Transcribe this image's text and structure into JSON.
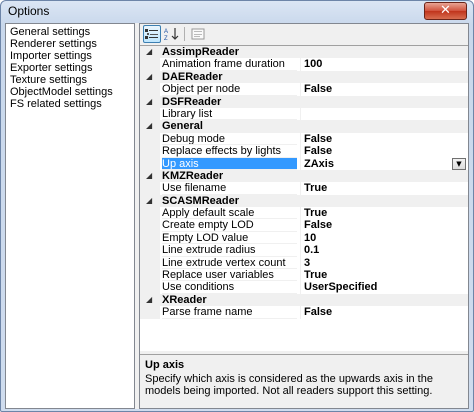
{
  "window": {
    "title": "Options",
    "close_glyph": "✕"
  },
  "categories": [
    "General settings",
    "Renderer settings",
    "Importer settings",
    "Exporter settings",
    "Texture settings",
    "ObjectModel settings",
    "FS related settings"
  ],
  "toolbar": {
    "categorized_icon": "categorized-icon",
    "alphabetical_icon": "alphabetical-sort-icon",
    "pages_icon": "property-pages-icon"
  },
  "grid": {
    "groups": [
      {
        "name": "AssimpReader",
        "props": [
          {
            "name": "Animation frame duration",
            "value": "100"
          }
        ]
      },
      {
        "name": "DAEReader",
        "props": [
          {
            "name": "Object per node",
            "value": "False"
          }
        ]
      },
      {
        "name": "DSFReader",
        "props": [
          {
            "name": "Library list",
            "value": ""
          }
        ]
      },
      {
        "name": "General",
        "props": [
          {
            "name": "Debug mode",
            "value": "False"
          },
          {
            "name": "Replace effects by lights",
            "value": "False"
          },
          {
            "name": "Up axis",
            "value": "ZAxis",
            "selected": true
          }
        ]
      },
      {
        "name": "KMZReader",
        "props": [
          {
            "name": "Use filename",
            "value": "True"
          }
        ]
      },
      {
        "name": "SCASMReader",
        "props": [
          {
            "name": "Apply default scale",
            "value": "True"
          },
          {
            "name": "Create empty LOD",
            "value": "False"
          },
          {
            "name": "Empty LOD value",
            "value": "10"
          },
          {
            "name": "Line extrude radius",
            "value": "0.1"
          },
          {
            "name": "Line extrude vertex count",
            "value": "3"
          },
          {
            "name": "Replace user variables",
            "value": "True"
          },
          {
            "name": "Use conditions",
            "value": "UserSpecified"
          }
        ]
      },
      {
        "name": "XReader",
        "props": [
          {
            "name": "Parse frame name",
            "value": "False"
          }
        ]
      }
    ],
    "group_glyph": "◢",
    "dropdown_glyph": "▼"
  },
  "description": {
    "title": "Up axis",
    "text": "Specify which axis is considered as the upwards axis in the models being imported. Not all readers support this setting."
  },
  "colors": {
    "selection": "#3399ff",
    "gutter": "#f0f0f0"
  }
}
